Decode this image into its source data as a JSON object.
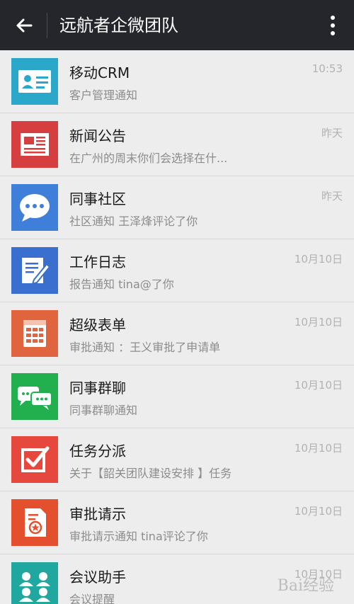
{
  "header": {
    "title": "远航者企微团队"
  },
  "conversations": [
    {
      "name": "移动CRM",
      "preview": "客户管理通知",
      "time": "10:53",
      "icon": "contact-card-icon",
      "color": "#2aa7c9"
    },
    {
      "name": "新闻公告",
      "preview": "在广州的周末你们会选择在什...",
      "time": "昨天",
      "icon": "newspaper-icon",
      "color": "#d63f3f"
    },
    {
      "name": "同事社区",
      "preview": "社区通知 王泽烽评论了你",
      "time": "昨天",
      "icon": "chat-bubble-icon",
      "color": "#3f7fd9"
    },
    {
      "name": "工作日志",
      "preview": "报告通知 tina@了你",
      "time": "10月10日",
      "icon": "edit-document-icon",
      "color": "#3a6fcf"
    },
    {
      "name": "超级表单",
      "preview": "审批通知 ：王义审批了申请单",
      "time": "10月10日",
      "icon": "form-grid-icon",
      "color": "#e0653f"
    },
    {
      "name": "同事群聊",
      "preview": "同事群聊通知",
      "time": "10月10日",
      "icon": "group-chat-icon",
      "color": "#22b04e"
    },
    {
      "name": "任务分派",
      "preview": "关于【韶关团队建设安排 】任务",
      "time": "10月10日",
      "icon": "checkbox-icon",
      "color": "#e6483e"
    },
    {
      "name": "审批请示",
      "preview": "审批请示通知  tina评论了你",
      "time": "10月10日",
      "icon": "stamp-document-icon",
      "color": "#e4502e"
    },
    {
      "name": "会议助手",
      "preview": "会议提醒",
      "time": "10月10日",
      "icon": "meeting-people-icon",
      "color": "#1fa7a0"
    }
  ],
  "watermark": "Bai经验"
}
